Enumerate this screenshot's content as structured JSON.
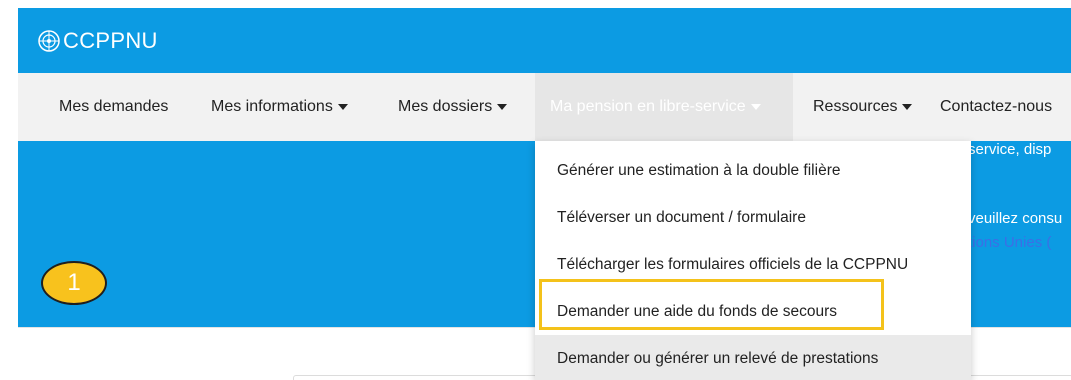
{
  "brand": {
    "name": "CCPPNU",
    "icon": "un-emblem-icon"
  },
  "nav": {
    "items": [
      {
        "label": "Mes demandes",
        "dropdown": false
      },
      {
        "label": "Mes informations",
        "dropdown": true
      },
      {
        "label": "Mes dossiers",
        "dropdown": true
      },
      {
        "label": "Ma pension en libre-service",
        "dropdown": true,
        "active": true
      },
      {
        "label": "Ressources",
        "dropdown": true
      },
      {
        "label": "Contactez-nous"
      }
    ]
  },
  "hero": {
    "line1": "service, disp",
    "line2": "veuillez consu",
    "link": "tions Unies ("
  },
  "dropdown": {
    "items": [
      "Générer une estimation à la double filière",
      "Téléverser un document / formulaire",
      "Télécharger les formulaires officiels de la CCPPNU",
      "Demander une aide du fonds de secours",
      "Demander ou générer un relevé de prestations"
    ]
  },
  "step_badge": "1",
  "colors": {
    "brand_blue": "#0c9be3",
    "highlight": "#f4c21a",
    "badge": "#f8c21d"
  }
}
